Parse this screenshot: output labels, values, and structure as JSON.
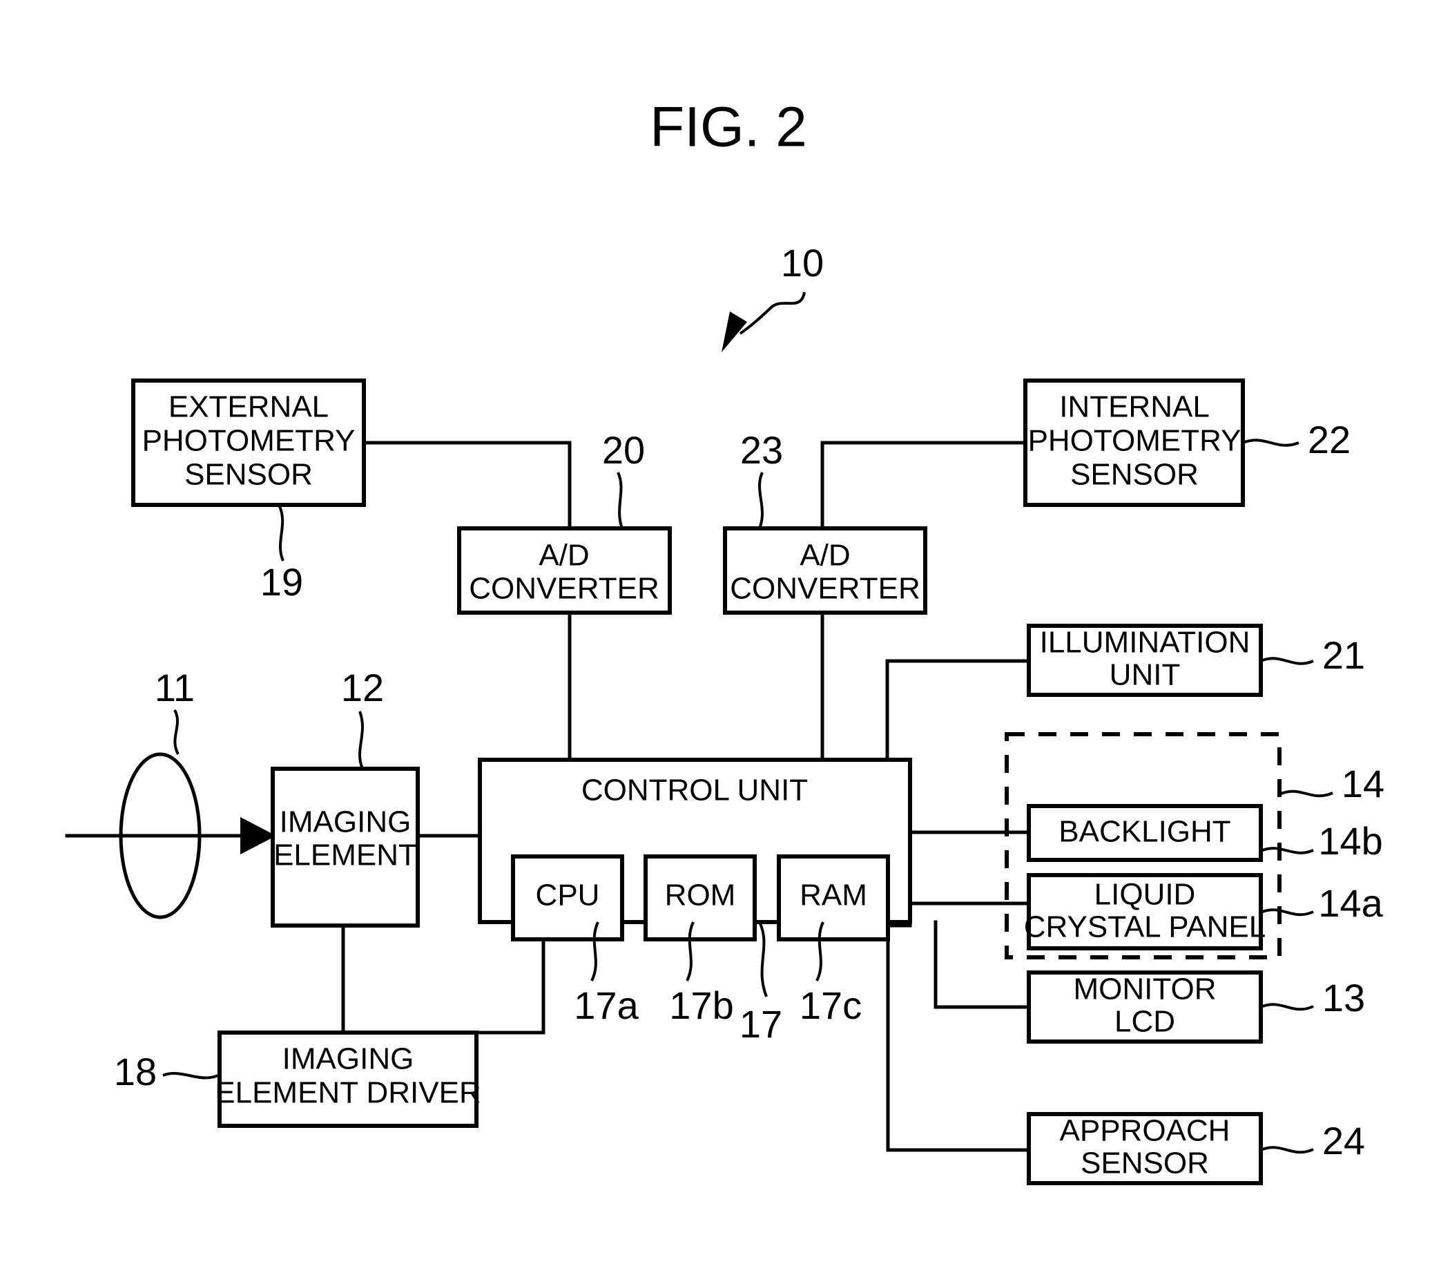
{
  "figure": {
    "title": "FIG. 2",
    "system_ref": "10"
  },
  "blocks": {
    "external_photometry_sensor": {
      "lines": [
        "EXTERNAL",
        "PHOTOMETRY",
        "SENSOR"
      ],
      "ref": "19"
    },
    "ad_converter_left": {
      "lines": [
        "A/D",
        "CONVERTER"
      ],
      "ref": "20"
    },
    "ad_converter_right": {
      "lines": [
        "A/D",
        "CONVERTER"
      ],
      "ref": "23"
    },
    "internal_photometry_sensor": {
      "lines": [
        "INTERNAL",
        "PHOTOMETRY",
        "SENSOR"
      ],
      "ref": "22"
    },
    "illumination_unit": {
      "lines": [
        "ILLUMINATION",
        "UNIT"
      ],
      "ref": "21"
    },
    "viewfinder_group": {
      "ref": "14"
    },
    "backlight": {
      "lines": [
        "BACKLIGHT"
      ],
      "ref": "14b"
    },
    "liquid_crystal_panel": {
      "lines": [
        "LIQUID",
        "CRYSTAL PANEL"
      ],
      "ref": "14a"
    },
    "monitor_lcd": {
      "lines": [
        "MONITOR",
        "LCD"
      ],
      "ref": "13"
    },
    "approach_sensor": {
      "lines": [
        "APPROACH",
        "SENSOR"
      ],
      "ref": "24"
    },
    "control_unit": {
      "lines": [
        "CONTROL UNIT"
      ],
      "ref": "17"
    },
    "cpu": {
      "lines": [
        "CPU"
      ],
      "ref": "17a"
    },
    "rom": {
      "lines": [
        "ROM"
      ],
      "ref": "17b"
    },
    "ram": {
      "lines": [
        "RAM"
      ],
      "ref": "17c"
    },
    "imaging_element": {
      "lines": [
        "IMAGING",
        "ELEMENT"
      ],
      "ref": "12"
    },
    "imaging_element_driver": {
      "lines": [
        "IMAGING",
        "ELEMENT DRIVER"
      ],
      "ref": "18"
    },
    "lens": {
      "ref": "11"
    }
  },
  "colors": {
    "line": "#000000",
    "background": "#ffffff",
    "text": "#000000"
  }
}
